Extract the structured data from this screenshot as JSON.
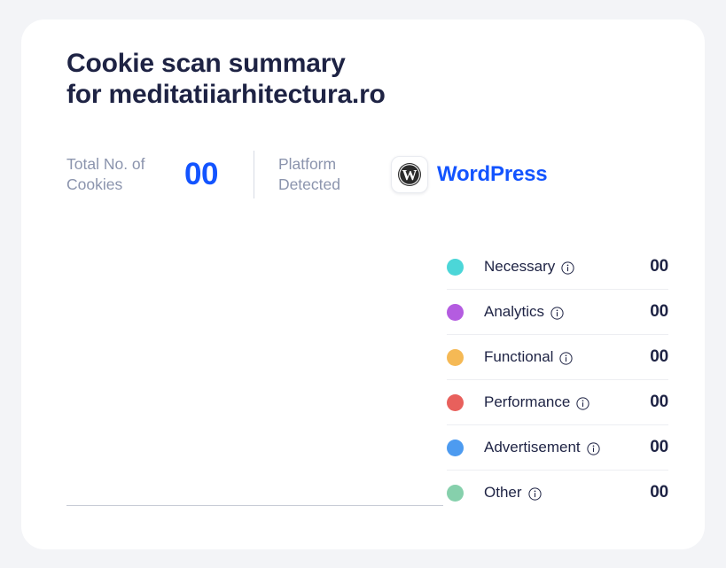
{
  "theme": {
    "page_background": "#f3f4f7",
    "card_background": "#ffffff",
    "accent_blue": "#1354ff",
    "heading_color": "#1e2344",
    "muted_text": "#8b94ad",
    "divider": "#edeef2"
  },
  "summary_card": {
    "title_line1": "Cookie scan summary",
    "title_line2": "for meditatiiarhitectura.ro",
    "stats": {
      "total_cookies": {
        "label_line1": "Total No. of",
        "label_line2": "Cookies",
        "value": "00"
      },
      "platform": {
        "label_line1": "Platform",
        "label_line2": "Detected",
        "name": "WordPress",
        "icon": "wordpress-icon"
      }
    },
    "legend": {
      "info_icon": "info-icon",
      "items": [
        {
          "label": "Necessary",
          "count": "00",
          "color": "#4cd6d8"
        },
        {
          "label": "Analytics",
          "count": "00",
          "color": "#b45ce0"
        },
        {
          "label": "Functional",
          "count": "00",
          "color": "#f5b955"
        },
        {
          "label": "Performance",
          "count": "00",
          "color": "#e8605c"
        },
        {
          "label": "Advertisement",
          "count": "00",
          "color": "#4d9bf0"
        },
        {
          "label": "Other",
          "count": "00",
          "color": "#86d0ac"
        }
      ]
    }
  },
  "chart_data": {
    "type": "pie",
    "title": "Cookie scan summary for meditatiiarhitectura.ro",
    "categories": [
      "Necessary",
      "Analytics",
      "Functional",
      "Performance",
      "Advertisement",
      "Other"
    ],
    "values": [
      0,
      0,
      0,
      0,
      0,
      0
    ],
    "colors": [
      "#4cd6d8",
      "#b45ce0",
      "#f5b955",
      "#e8605c",
      "#4d9bf0",
      "#86d0ac"
    ],
    "total": 0,
    "legend_position": "right",
    "grid": false
  }
}
